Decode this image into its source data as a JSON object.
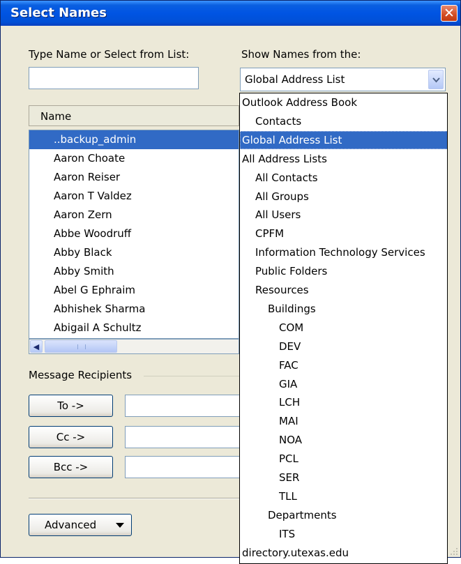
{
  "window": {
    "title": "Select Names",
    "close_glyph": "✕"
  },
  "search": {
    "label": "Type Name or Select from List:",
    "value": ""
  },
  "source": {
    "label": "Show Names from the:",
    "selected": "Global Address List"
  },
  "names_list": {
    "column_header": "Name",
    "items": [
      "..backup_admin",
      "Aaron Choate",
      "Aaron Reiser",
      "Aaron T Valdez",
      "Aaron Zern",
      "Abbe Woodruff",
      "Abby Black",
      "Abby Smith",
      "Abel G Ephraim",
      "Abhishek Sharma",
      "Abigail A Schultz"
    ],
    "selected_index": 0
  },
  "recipients": {
    "group_label": "Message Recipients",
    "to_label": "To ->",
    "cc_label": "Cc ->",
    "bcc_label": "Bcc ->",
    "to_value": "",
    "cc_value": "",
    "bcc_value": ""
  },
  "advanced": {
    "label": "Advanced"
  },
  "dropdown": {
    "selected_index": 2,
    "items": [
      {
        "label": "Outlook Address Book",
        "level": 0
      },
      {
        "label": "Contacts",
        "level": 1
      },
      {
        "label": "Global Address List",
        "level": 0
      },
      {
        "label": "All Address Lists",
        "level": 0
      },
      {
        "label": "All Contacts",
        "level": 1
      },
      {
        "label": "All Groups",
        "level": 1
      },
      {
        "label": "All Users",
        "level": 1
      },
      {
        "label": "CPFM",
        "level": 1
      },
      {
        "label": "Information Technology Services",
        "level": 1
      },
      {
        "label": "Public Folders",
        "level": 1
      },
      {
        "label": "Resources",
        "level": 1
      },
      {
        "label": "Buildings",
        "level": 2
      },
      {
        "label": "COM",
        "level": 3
      },
      {
        "label": "DEV",
        "level": 3
      },
      {
        "label": "FAC",
        "level": 3
      },
      {
        "label": "GIA",
        "level": 3
      },
      {
        "label": "LCH",
        "level": 3
      },
      {
        "label": "MAI",
        "level": 3
      },
      {
        "label": "NOA",
        "level": 3
      },
      {
        "label": "PCL",
        "level": 3
      },
      {
        "label": "SER",
        "level": 3
      },
      {
        "label": "TLL",
        "level": 3
      },
      {
        "label": "Departments",
        "level": 2
      },
      {
        "label": "ITS",
        "level": 3
      },
      {
        "label": "directory.utexas.edu",
        "level": 0
      }
    ]
  },
  "colors": {
    "title_bar": "#0054e3",
    "selection": "#316ac5",
    "dialog_face": "#ece9d8"
  }
}
